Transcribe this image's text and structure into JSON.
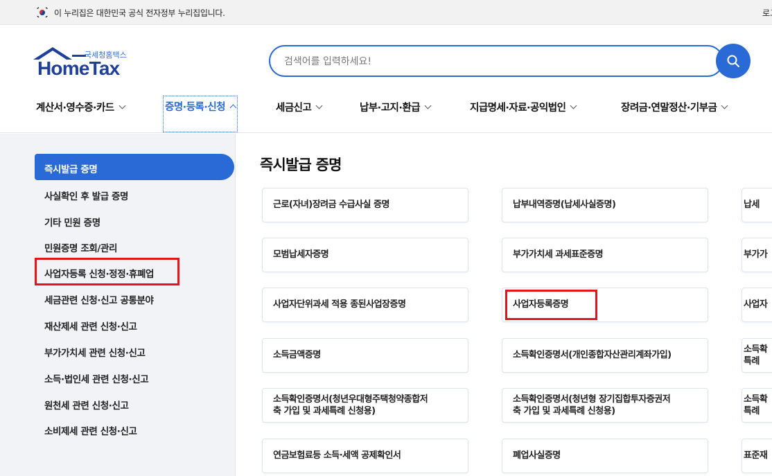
{
  "gov_banner": {
    "text": "이 누리집은 대한민국 공식 전자정부 누리집입니다.",
    "login": "로그"
  },
  "logo": {
    "sub": "국세청홈택스",
    "main": "HomeTax"
  },
  "search": {
    "placeholder": "검색어를 입력하세요!"
  },
  "nav": {
    "items": [
      {
        "label": "계산서·영수증·카드"
      },
      {
        "label": "증명·등록·신청"
      },
      {
        "label": "세금신고"
      },
      {
        "label": "납부·고지·환급"
      },
      {
        "label": "지급명세·자료·공익법인"
      },
      {
        "label": "장려금·연말정산·기부금"
      }
    ]
  },
  "sidebar": {
    "items": [
      {
        "label": "즉시발급 증명"
      },
      {
        "label": "사실확인 후 발급 증명"
      },
      {
        "label": "기타 민원 증명"
      },
      {
        "label": "민원증명 조회/관리"
      },
      {
        "label": "사업자등록 신청·정정·휴폐업"
      },
      {
        "label": "세금관련 신청·신고 공통분야"
      },
      {
        "label": "재산제세 관련 신청·신고"
      },
      {
        "label": "부가가치세 관련 신청·신고"
      },
      {
        "label": "소득·법인세 관련 신청·신고"
      },
      {
        "label": "원천세 관련 신청·신고"
      },
      {
        "label": "소비제세 관련 신청·신고"
      }
    ]
  },
  "content": {
    "title": "즉시발급 증명",
    "rows": [
      [
        "근로(자녀)장려금 수급사실 증명",
        "납부내역증명(납세사실증명)",
        "납세"
      ],
      [
        "모범납세자증명",
        "부가가치세 과세표준증명",
        "부가가"
      ],
      [
        "사업자단위과세 적용 종된사업장증명",
        "사업자등록증명",
        "사업자"
      ],
      [
        "소득금액증명",
        "소득확인증명서(개인종합자산관리계좌가입)",
        "소득확\n특례"
      ],
      [
        "소득확인증명서(청년우대형주택청약종합저\n축 가입 및 과세특례 신청용)",
        "소득확인증명서(청년형 장기집합투자증권저\n축 가입 및 과세특례 신청용)",
        "소득확\n특례"
      ],
      [
        "연금보험료등 소득·세액 공제확인서",
        "폐업사실증명",
        "표준재"
      ]
    ]
  },
  "colors": {
    "accent": "#2a6ad6",
    "highlight_box": "#e0161b"
  }
}
